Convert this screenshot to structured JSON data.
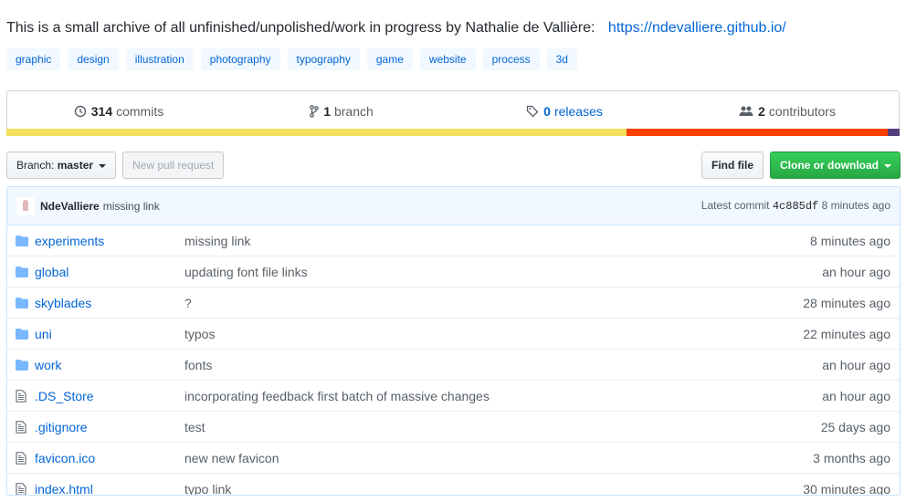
{
  "description": {
    "text": "This is a small archive of all unfinished/unpolished/work in progress by Nathalie de Vallière:",
    "link": "https://ndevalliere.github.io/"
  },
  "topics": [
    "graphic",
    "design",
    "illustration",
    "photography",
    "typography",
    "game",
    "website",
    "process",
    "3d"
  ],
  "summary": {
    "commits": {
      "count": "314",
      "label": "commits"
    },
    "branches": {
      "count": "1",
      "label": "branch"
    },
    "releases": {
      "count": "0",
      "label": "releases"
    },
    "contributors": {
      "count": "2",
      "label": "contributors"
    }
  },
  "languages": [
    {
      "color": "#f1e05a",
      "percent": 69.4
    },
    {
      "color": "#ff3f00",
      "percent": 29.3
    },
    {
      "color": "#563d7c",
      "percent": 1.3
    }
  ],
  "toolbar": {
    "branch_label": "Branch:",
    "branch_value": "master",
    "new_pr": "New pull request",
    "find_file": "Find file",
    "clone": "Clone or download"
  },
  "latest_commit": {
    "author": "NdeValliere",
    "message": "missing link",
    "label": "Latest commit",
    "sha": "4c885df",
    "age": "8 minutes ago"
  },
  "files": [
    {
      "type": "dir",
      "name": "experiments",
      "message": "missing link",
      "age": "8 minutes ago"
    },
    {
      "type": "dir",
      "name": "global",
      "message": "updating font file links",
      "age": "an hour ago"
    },
    {
      "type": "dir",
      "name": "skyblades",
      "message": "?",
      "age": "28 minutes ago"
    },
    {
      "type": "dir",
      "name": "uni",
      "message": "typos",
      "age": "22 minutes ago"
    },
    {
      "type": "dir",
      "name": "work",
      "message": "fonts",
      "age": "an hour ago"
    },
    {
      "type": "file",
      "name": ".DS_Store",
      "message": "incorporating feedback first batch of massive changes",
      "age": "an hour ago"
    },
    {
      "type": "file",
      "name": ".gitignore",
      "message": "test",
      "age": "25 days ago"
    },
    {
      "type": "file",
      "name": "favicon.ico",
      "message": "new new favicon",
      "age": "3 months ago"
    },
    {
      "type": "file",
      "name": "index.html",
      "message": "typo link",
      "age": "30 minutes ago"
    }
  ]
}
